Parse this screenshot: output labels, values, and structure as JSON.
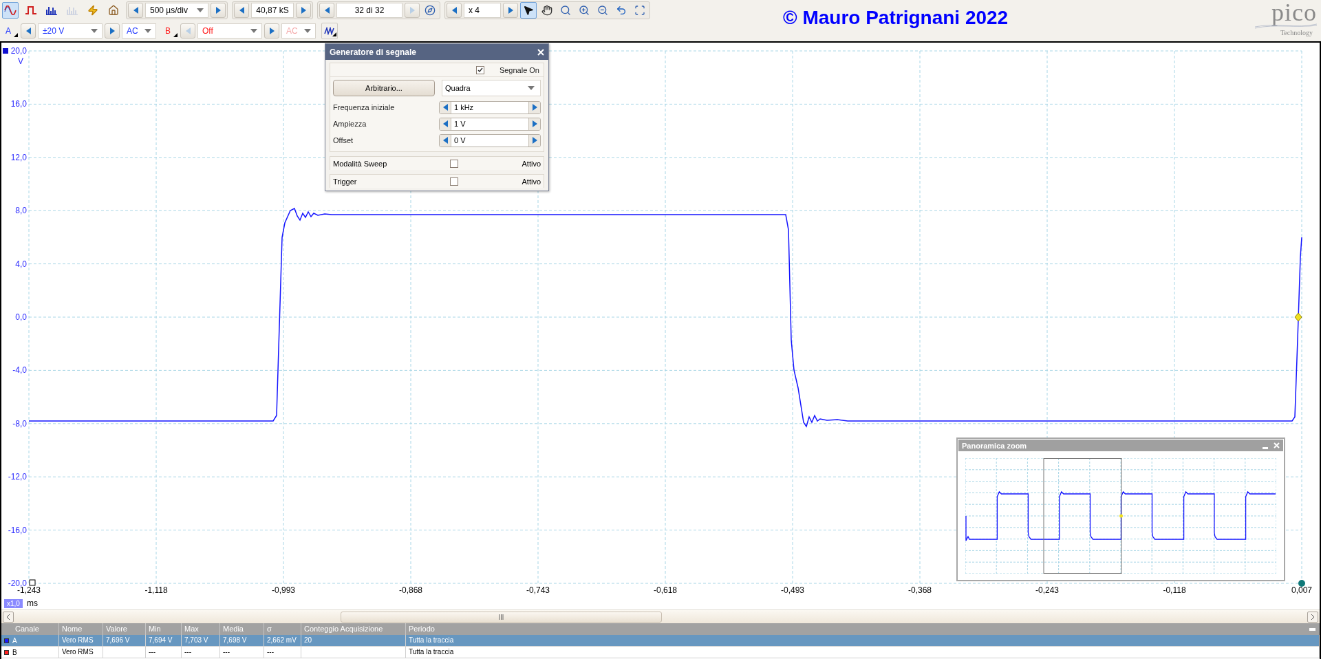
{
  "toolbar": {
    "mode_buttons": [
      {
        "kind": "scope",
        "selected": true,
        "disabled": false
      },
      {
        "kind": "persistence",
        "selected": false,
        "disabled": false
      },
      {
        "kind": "spectrum",
        "selected": false,
        "disabled": false
      },
      {
        "kind": "spectrum",
        "selected": false,
        "disabled": true
      }
    ],
    "timebase": "500 µs/div",
    "samples": "40,87 kS",
    "buffer": {
      "value": "32 di 32",
      "next_disabled": true
    },
    "zoom": "x 4",
    "tools": [
      {
        "kind": "pointer",
        "selected": true
      },
      {
        "kind": "hand",
        "selected": false
      },
      {
        "kind": "zoom-area",
        "selected": false
      },
      {
        "kind": "zoom-in",
        "selected": false
      },
      {
        "kind": "zoom-out",
        "selected": false
      },
      {
        "kind": "undo",
        "selected": false
      },
      {
        "kind": "zoom-fit",
        "selected": false
      }
    ]
  },
  "channels": [
    {
      "name": "A",
      "range": "±20 V",
      "coupling": "AC",
      "enabled": true,
      "color": "#1a32ff"
    },
    {
      "name": "B",
      "range": "Off",
      "coupling": "AC",
      "enabled": false,
      "color": "#ff1a1a"
    }
  ],
  "caption": "© Mauro Patrignani 2022",
  "logo": {
    "name": "pico",
    "subtitle": "Technology"
  },
  "plot": {
    "y_labels": [
      "20,0",
      "16,0",
      "12,0",
      "8,0",
      "4,0",
      "0,0",
      "-4,0",
      "-8,0",
      "-12,0",
      "-16,0",
      "-20,0"
    ],
    "y_unit": "V",
    "x_labels": [
      "-1,243",
      "-1,118",
      "-0,993",
      "-0,868",
      "-0,743",
      "-0,618",
      "-0,493",
      "-0,368",
      "-0,243",
      "-0,118",
      "0,007"
    ],
    "x_zoom": "x1,0",
    "x_unit": "ms"
  },
  "generator": {
    "title": "Generatore di segnale",
    "signal_on": {
      "label": "Segnale On",
      "checked": true
    },
    "arbitrary_button": "Arbitrario...",
    "waveform": "Quadra",
    "fields": [
      {
        "label": "Frequenza iniziale",
        "value": "1 kHz"
      },
      {
        "label": "Ampiezza",
        "value": "1 V"
      },
      {
        "label": "Offset",
        "value": "0 V"
      }
    ],
    "options": [
      {
        "label": "Modalità Sweep",
        "checkbox_label": "Attivo",
        "checked": false
      },
      {
        "label": "Trigger",
        "checkbox_label": "Attivo",
        "checked": false
      }
    ]
  },
  "zoom_overview": {
    "title": "Panoramica zoom"
  },
  "measurements": {
    "columns": [
      "Canale",
      "Nome",
      "Valore",
      "Min",
      "Max",
      "Media",
      "σ",
      "Conteggio Acquisizione",
      "Periodo"
    ],
    "rows": [
      {
        "channel": "A",
        "color": "#1a1aff",
        "selected": true,
        "name": "Vero RMS",
        "value": "7,696 V",
        "min": "7,694 V",
        "max": "7,703 V",
        "mean": "7,698 V",
        "sigma": "2,662 mV",
        "count": "20",
        "period": "Tutta la traccia"
      },
      {
        "channel": "B",
        "color": "#ff2020",
        "selected": false,
        "name": "Vero RMS",
        "min": "---",
        "max": "---",
        "mean": "---",
        "sigma": "---",
        "period": "Tutta la traccia"
      }
    ]
  }
}
